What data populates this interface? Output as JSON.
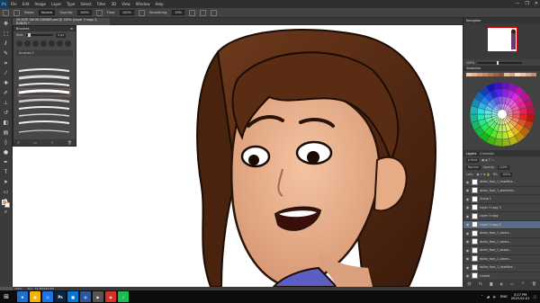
{
  "app": {
    "logo": "Ps",
    "menu": [
      "File",
      "Edit",
      "Image",
      "Layer",
      "Type",
      "Select",
      "Filter",
      "3D",
      "View",
      "Window",
      "Help"
    ],
    "window_controls": [
      "—",
      "❐",
      "✕"
    ]
  },
  "options_bar": {
    "mode_label": "Mode:",
    "mode_value": "Normal",
    "opacity_label": "Opacity:",
    "opacity_value": "100%",
    "flow_label": "Flow:",
    "flow_value": "100%",
    "smoothing_label": "Smoothing:",
    "smoothing_value": "10%"
  },
  "document": {
    "tab_title": "29-FATE SNOW DINNER.psd @ 100% (Layer 3 copy 2, RGB/8) *"
  },
  "brushes_panel": {
    "title": "Brushes",
    "size_label": "Size:",
    "size_value": "4 px",
    "folder_label": "brushes 2"
  },
  "navigator": {
    "title": "Navigator",
    "zoom_value": "100%"
  },
  "swatches": {
    "title": "Swatches",
    "colors": [
      "#f2c9a8",
      "#e8b590",
      "#d99d74",
      "#c98862",
      "#b87552",
      "#a46245",
      "#8e5238",
      "#e6b79c",
      "#d4a080",
      "#f5dcc8",
      "#eec4a6",
      "#dca88a",
      "#c49074"
    ]
  },
  "layers": {
    "tabs": [
      "Layers",
      "Channels"
    ],
    "kind_label": "ρ Kind",
    "blend_value": "Normal",
    "opacity_label": "Opacity:",
    "opacity_value": "100%",
    "lock_label": "Lock:",
    "fill_label": "Fill:",
    "fill_value": "100%",
    "rows": [
      {
        "name": "dollar_face_1_headline...",
        "selected": false
      },
      {
        "name": "dollar_face_1_sketched...",
        "selected": false
      },
      {
        "name": "Group 1",
        "selected": false
      },
      {
        "name": "Layer 3 copy 3",
        "selected": false
      },
      {
        "name": "Layer 3 copy",
        "selected": false
      },
      {
        "name": "Layer 3 copy 2",
        "selected": true
      },
      {
        "name": "dollar_face_1_colors...",
        "selected": false
      },
      {
        "name": "dollar_face_1_colors...",
        "selected": false
      },
      {
        "name": "dollar_face_1_shape...",
        "selected": false
      },
      {
        "name": "dollar_face_1_colors...",
        "selected": false
      },
      {
        "name": "dollar_face_1_headline...",
        "selected": false
      },
      {
        "name": "Lineart",
        "selected": false
      },
      {
        "name": "color after",
        "selected": false
      }
    ]
  },
  "status": {
    "zoom": "100%",
    "doc_info": "Doc: 34.3M/263.8M"
  },
  "taskbar": {
    "apps": [
      {
        "label": "e",
        "color": "#1f6fd1"
      },
      {
        "label": "▣",
        "color": "#f5b400"
      },
      {
        "label": "◎",
        "color": "#1a73e8"
      },
      {
        "label": "Ps",
        "color": "#0a2540"
      },
      {
        "label": "■",
        "color": "#0078d7"
      },
      {
        "label": "◍",
        "color": "#2b579a"
      },
      {
        "label": "▶",
        "color": "#555555"
      },
      {
        "label": "◉",
        "color": "#d93025"
      },
      {
        "label": "♪",
        "color": "#1db954"
      }
    ],
    "lang": "ENG",
    "time": "3:27 PM",
    "date": "2019-02-01"
  }
}
